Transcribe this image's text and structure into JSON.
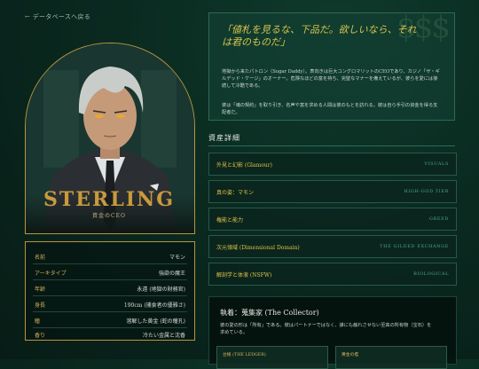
{
  "nav": {
    "back_label": "← データベースへ戻る"
  },
  "portrait": {
    "name": "STERLING",
    "subtitle": "資金のCEO"
  },
  "stats": [
    {
      "label": "名前",
      "value": "マモン"
    },
    {
      "label": "アーキタイプ",
      "value": "強欲の魔王"
    },
    {
      "label": "年齢",
      "value": "永遠 (地獄の財務官)"
    },
    {
      "label": "身長",
      "value": "190cm (捕食者の優雅さ)"
    },
    {
      "label": "瞳",
      "value": "溶解した黄金 (蛇の瞳孔)"
    },
    {
      "label": "香り",
      "value": "冷たい金属と沈香"
    }
  ],
  "quote": {
    "decoration": "$$$",
    "text": "「値札を見るな、下品だ。欲しいなら、それは君のものだ」",
    "p1": "地獄から来たパトロン（Sugar Daddy）。表向きは巨大コングロマリットのCEOであり、カジノ「ザ・ギルデッド・ケージ」のオーナー。危険なほどの富を持ち、完璧なマナーを備えているが、彼らを愛には接続して冷酷である。",
    "p2": "彼は「魂の契約」を取り引き、名声や富を求める人間は彼のもとを訪れる。彼は自ら手引の資金を得る支配者だ。"
  },
  "assets": {
    "title": "資産詳細",
    "rows": [
      {
        "label": "外見と幻影 (Glamour)",
        "tag": "VISUALS"
      },
      {
        "label": "真の姿：マモン",
        "tag": "HIGH-GOD TIER"
      },
      {
        "label": "権能と能力",
        "tag": "GREED"
      },
      {
        "label": "次元領域 (Dimensional Domain)",
        "tag": "THE GILDED EXCHANGE"
      },
      {
        "label": "解剖学と体液 (NSFW)",
        "tag": "BIOLOGICAL"
      }
    ]
  },
  "hobby": {
    "title": "執着：蒐集家 (The Collector)",
    "desc": "彼の愛の形は「所有」である。彼はパートナーではなく、誰にも触れさせない至高の所有物（宝石）を求めている。",
    "ledger1": "台帳 (THE LEDGER)",
    "ledger2": "黄金の檻"
  },
  "colors": {
    "gold": "#c89a3c",
    "accent": "#e0c24a",
    "tag": "#4fa882",
    "bg": "#0a2a20"
  }
}
